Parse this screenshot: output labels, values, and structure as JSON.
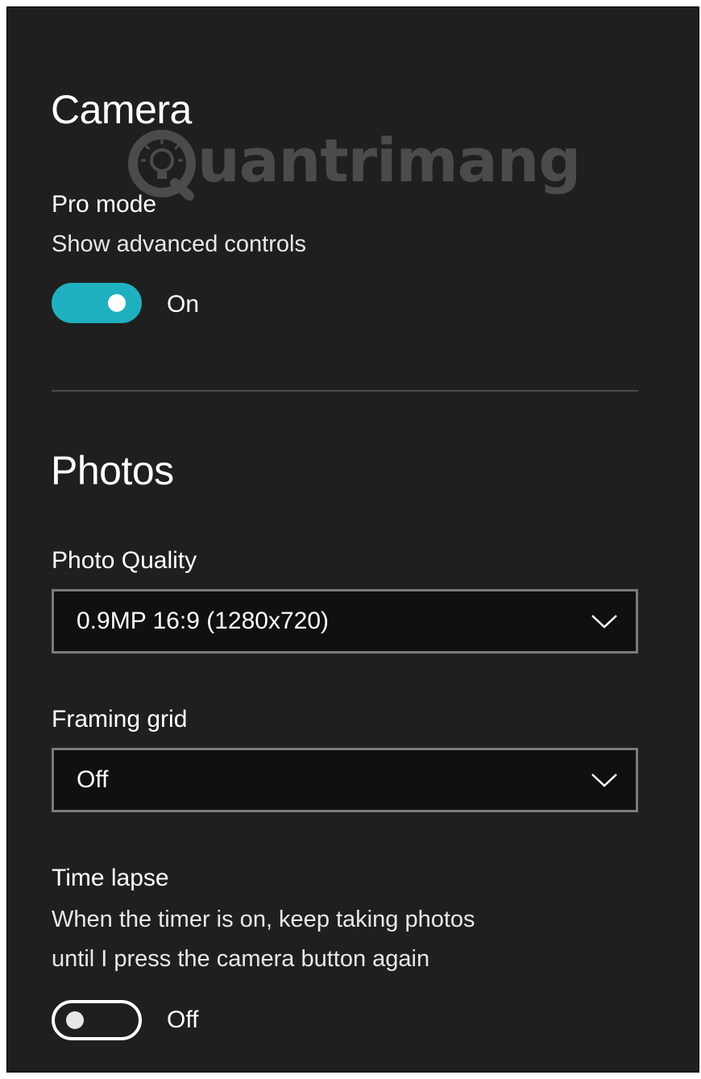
{
  "watermark": {
    "text": "uantrimang",
    "icon": "lightbulb-q-logo-icon"
  },
  "camera": {
    "title": "Camera",
    "pro_mode": {
      "label": "Pro mode",
      "description": "Show advanced controls",
      "state_label": "On",
      "enabled": true
    }
  },
  "photos": {
    "title": "Photos",
    "photo_quality": {
      "label": "Photo Quality",
      "value": "0.9MP 16:9 (1280x720)",
      "icon": "chevron-down-icon"
    },
    "framing_grid": {
      "label": "Framing grid",
      "value": "Off",
      "icon": "chevron-down-icon"
    },
    "time_lapse": {
      "label": "Time lapse",
      "description_line1": "When the timer is on, keep taking photos",
      "description_line2": "until I press the camera button again",
      "state_label": "Off",
      "enabled": false
    }
  },
  "colors": {
    "background": "#1f1f1f",
    "accent": "#1fb0bf",
    "text": "#ffffff",
    "select_background": "#101010",
    "select_border": "#7a7a7a"
  }
}
